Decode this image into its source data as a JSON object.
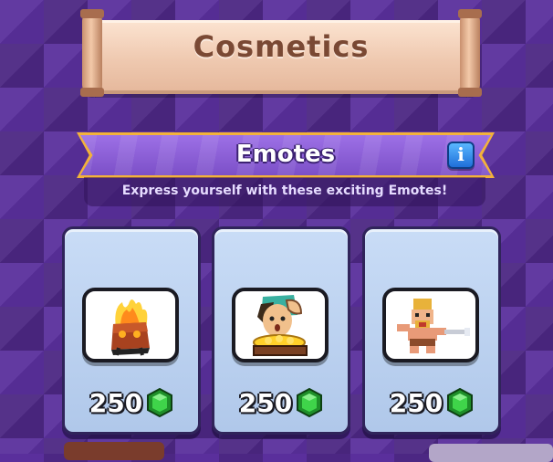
{
  "header": {
    "title": "Cosmetics"
  },
  "section": {
    "title": "Emotes",
    "info_icon": "i",
    "subtitle": "Express yourself with these exciting Emotes!"
  },
  "items": [
    {
      "emote": "flaming-rock-emote-icon",
      "price": "250",
      "currency_icon": "green-gem-icon"
    },
    {
      "emote": "salute-gold-pile-emote-icon",
      "price": "250",
      "currency_icon": "green-gem-icon"
    },
    {
      "emote": "barbarian-sword-emote-icon",
      "price": "250",
      "currency_icon": "green-gem-icon"
    }
  ],
  "colors": {
    "background": "#5a2f9c",
    "banner": "#7c50c8",
    "banner_edge": "#f3b23a",
    "card": "#c9dcf6",
    "gem": "#2fbf3a"
  }
}
